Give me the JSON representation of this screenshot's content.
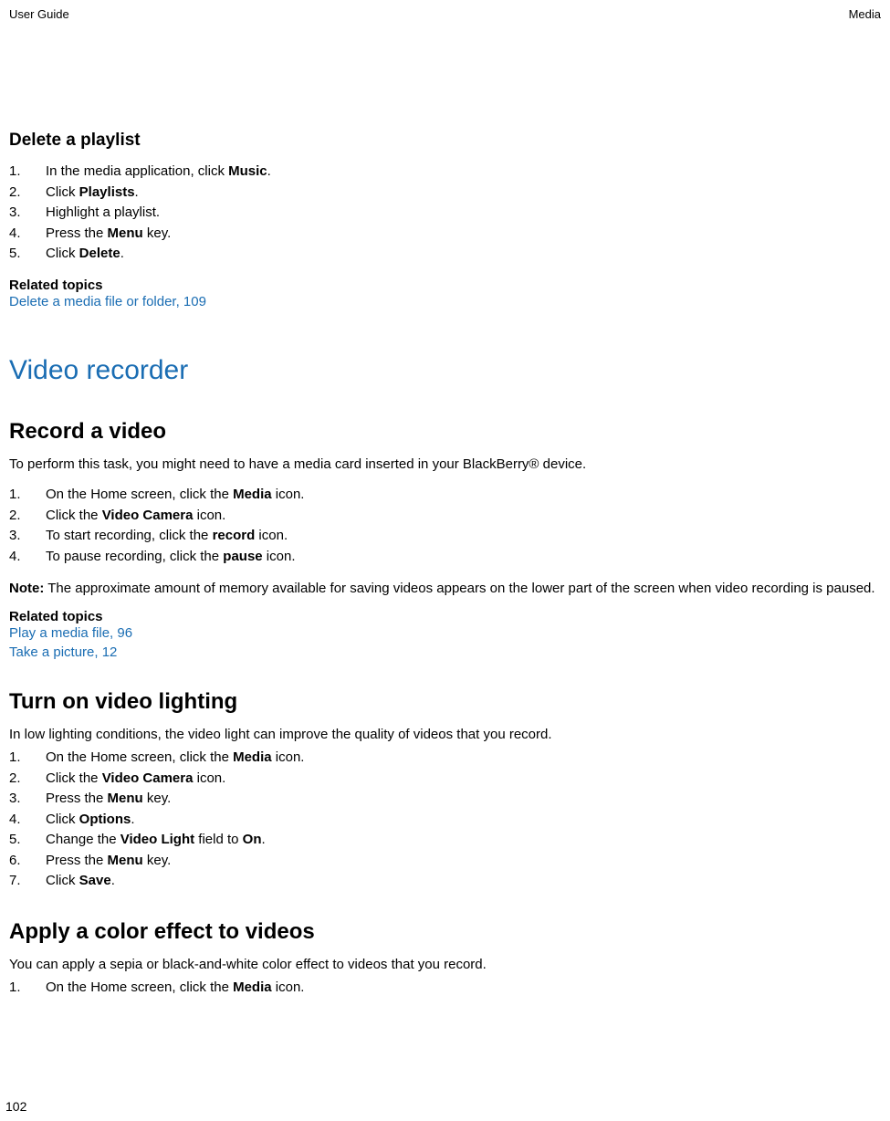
{
  "header": {
    "left": "User Guide",
    "right": "Media"
  },
  "footer": {
    "page": "102"
  },
  "s1": {
    "title": "Delete a playlist",
    "steps": [
      {
        "pre": "In the media application, click ",
        "bold": "Music",
        "post": "."
      },
      {
        "pre": "Click ",
        "bold": "Playlists",
        "post": "."
      },
      {
        "pre": "Highlight a playlist.",
        "bold": "",
        "post": ""
      },
      {
        "pre": "Press the ",
        "bold": "Menu",
        "post": " key."
      },
      {
        "pre": "Click ",
        "bold": "Delete",
        "post": "."
      }
    ],
    "related_label": "Related topics",
    "related_links": [
      "Delete a media file or folder, 109"
    ]
  },
  "chapter": {
    "title": "Video recorder"
  },
  "s2": {
    "title": "Record a video",
    "intro": "To perform this task, you might need to have a media card inserted in your BlackBerry® device.",
    "steps": [
      {
        "pre": "On the Home screen, click the ",
        "bold": "Media",
        "post": " icon."
      },
      {
        "pre": "Click the ",
        "bold": "Video Camera",
        "post": " icon."
      },
      {
        "pre": "To start recording, click the ",
        "bold": "record",
        "post": " icon."
      },
      {
        "pre": "To pause recording, click the ",
        "bold": "pause",
        "post": " icon."
      }
    ],
    "note": {
      "prefix": "Note:",
      "body": "  The approximate amount of memory available for saving videos appears on the lower part of the screen when video recording is paused."
    },
    "related_label": "Related topics",
    "related_links": [
      "Play a media file, 96",
      "Take a picture, 12"
    ]
  },
  "s3": {
    "title": "Turn on video lighting",
    "intro": "In low lighting conditions, the video light can improve the quality of videos that you record.",
    "steps": [
      {
        "pre": "On the Home screen, click the ",
        "bold": "Media",
        "post": " icon."
      },
      {
        "pre": "Click the ",
        "bold": "Video Camera",
        "post": " icon."
      },
      {
        "pre": "Press the ",
        "bold": "Menu",
        "post": " key."
      },
      {
        "pre": "Click ",
        "bold": "Options",
        "post": "."
      },
      {
        "pre": "Change the ",
        "bold": "Video Light",
        "post": " field to ",
        "bold2": "On",
        "post2": "."
      },
      {
        "pre": "Press the ",
        "bold": "Menu",
        "post": " key."
      },
      {
        "pre": "Click ",
        "bold": "Save",
        "post": "."
      }
    ]
  },
  "s4": {
    "title": "Apply a color effect to videos",
    "intro": "You can apply a sepia or black-and-white color effect to videos that you record.",
    "steps": [
      {
        "pre": "On the Home screen, click the ",
        "bold": "Media",
        "post": " icon."
      }
    ]
  }
}
